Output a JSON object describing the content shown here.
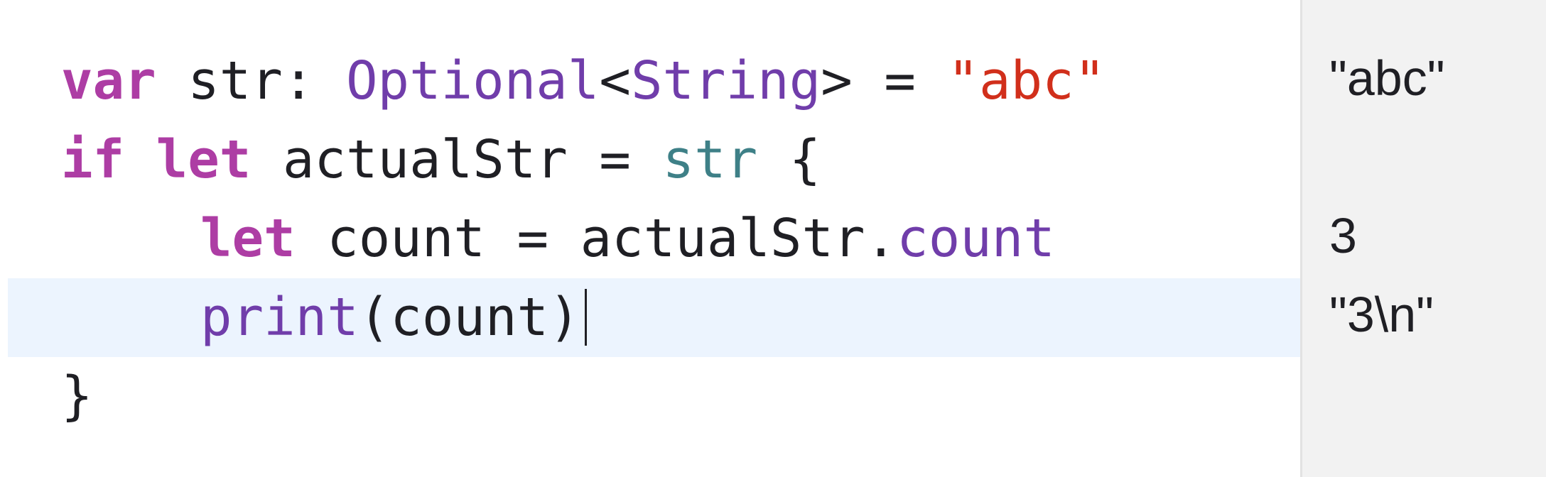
{
  "code": {
    "line1": {
      "kw_var": "var",
      "ident": " str: ",
      "type_optional": "Optional",
      "lt": "<",
      "type_string": "String",
      "gt_eq": "> = ",
      "string_literal": "\"abc\""
    },
    "line2": {
      "kw_if": "if",
      "space1": " ",
      "kw_let": "let",
      "ident": " actualStr = ",
      "local_str": "str",
      "brace": " {"
    },
    "line3": {
      "kw_let": "let",
      "ident": " count = actualStr.",
      "member_count": "count"
    },
    "line4": {
      "func_print": "print",
      "args": "(count)"
    },
    "line5": {
      "brace": "}"
    }
  },
  "results": {
    "line1": "\"abc\"",
    "line3": "3",
    "line4": "\"3\\n\""
  },
  "colors": {
    "keyword": "#ad3da4",
    "type": "#703daa",
    "string": "#d12f1b",
    "local": "#3e8087",
    "highlight": "#ecf4fe",
    "results_bg": "#f2f2f2"
  }
}
